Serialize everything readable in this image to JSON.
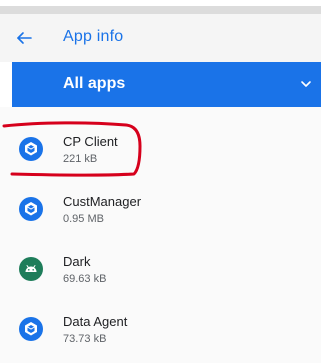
{
  "appbar": {
    "title": "App info",
    "back_icon": "arrow-back-icon",
    "accent_color": "#1a73e8"
  },
  "filter": {
    "selected": "All apps",
    "chevron_icon": "chevron-down-icon",
    "color": "#1a73e8"
  },
  "apps": [
    {
      "name": "CP Client",
      "size": "221 kB",
      "icon": "blue-shield-icon",
      "icon_color": "#1a73e8"
    },
    {
      "name": "CustManager",
      "size": "0.95 MB",
      "icon": "blue-shield-icon",
      "icon_color": "#1a73e8"
    },
    {
      "name": "Dark",
      "size": "69.63 kB",
      "icon": "android-icon",
      "icon_color": "#1e7d5a"
    },
    {
      "name": "Data Agent",
      "size": "73.73 kB",
      "icon": "blue-shield-icon",
      "icon_color": "#1a73e8"
    }
  ],
  "annotation": {
    "color": "#d6001c",
    "target": "CP Client"
  }
}
